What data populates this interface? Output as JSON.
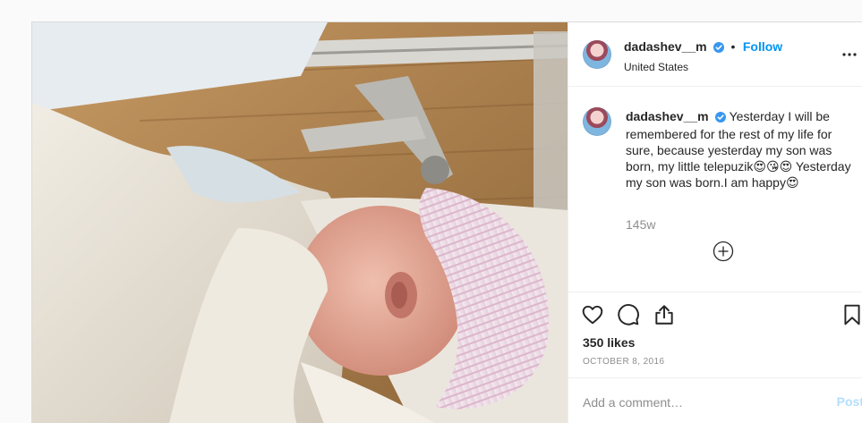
{
  "post": {
    "username": "dadashev__m",
    "follow_label": "Follow",
    "dot": "•",
    "location": "United States",
    "more_label": "•••",
    "caption": {
      "username": "dadashev__m",
      "text": "Yesterday I will be remembered for the rest of my life for sure, because yesterday my son was born, my little telepuzik😍😘😍 Yesterday my son was born.I am happy😍"
    },
    "time_ago": "145w",
    "likes": "350 likes",
    "date": "OCTOBER 8, 2016",
    "comment_placeholder": "Add a comment…",
    "post_label": "Post"
  },
  "colors": {
    "accent": "#0095f6",
    "post_disabled": "#b2dffc",
    "muted": "#8e8e8e",
    "text": "#262626"
  },
  "icons": {
    "verified": "verified-badge-icon",
    "more": "more-options-icon",
    "load_more": "plus-circle-icon",
    "like": "heart-icon",
    "comment": "comment-bubble-icon",
    "share": "share-arrow-icon",
    "save": "bookmark-icon"
  }
}
